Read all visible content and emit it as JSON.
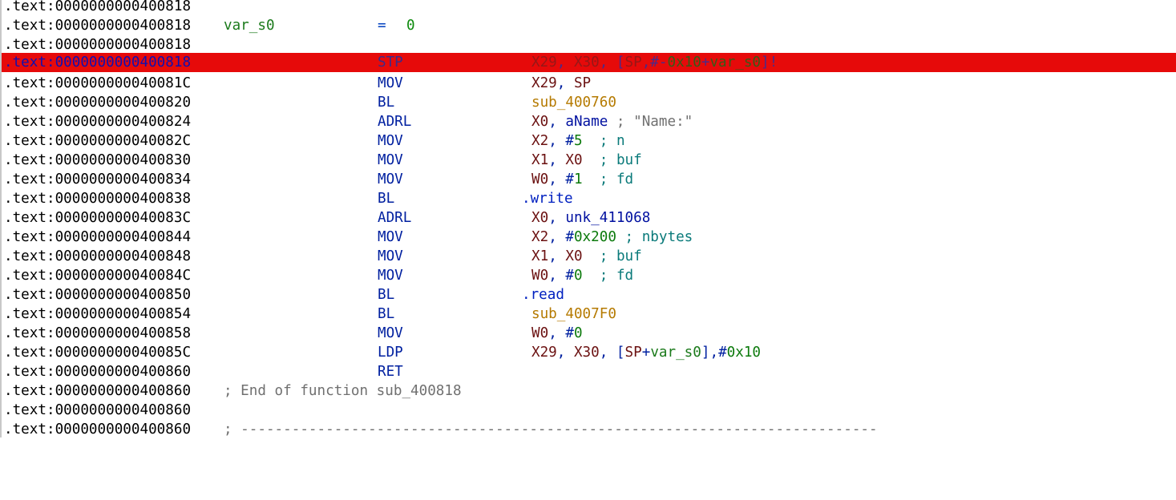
{
  "address_prefix": ".text:",
  "lines": [
    {
      "addr": "0000000000400818"
    },
    {
      "addr": "0000000000400818",
      "label": "var_s0",
      "eq": "=",
      "eqval": "0"
    },
    {
      "addr": "0000000000400818"
    },
    {
      "addr": "0000000000400818",
      "mnem": "STP",
      "highlight": true
    },
    {
      "addr": "000000000040081C",
      "mnem": "MOV"
    },
    {
      "addr": "0000000000400820",
      "mnem": "BL"
    },
    {
      "addr": "0000000000400824",
      "mnem": "ADRL"
    },
    {
      "addr": "000000000040082C",
      "mnem": "MOV"
    },
    {
      "addr": "0000000000400830",
      "mnem": "MOV"
    },
    {
      "addr": "0000000000400834",
      "mnem": "MOV"
    },
    {
      "addr": "0000000000400838",
      "mnem": "BL"
    },
    {
      "addr": "000000000040083C",
      "mnem": "ADRL"
    },
    {
      "addr": "0000000000400844",
      "mnem": "MOV"
    },
    {
      "addr": "0000000000400848",
      "mnem": "MOV"
    },
    {
      "addr": "000000000040084C",
      "mnem": "MOV"
    },
    {
      "addr": "0000000000400850",
      "mnem": "BL"
    },
    {
      "addr": "0000000000400854",
      "mnem": "BL"
    },
    {
      "addr": "0000000000400858",
      "mnem": "MOV"
    },
    {
      "addr": "000000000040085C",
      "mnem": "LDP"
    },
    {
      "addr": "0000000000400860",
      "mnem": "RET"
    },
    {
      "addr": "0000000000400860",
      "comment": "; End of function sub_400818"
    },
    {
      "addr": "0000000000400860"
    },
    {
      "addr": "0000000000400860",
      "comment": "; ---------------------------------------------------------------------------"
    }
  ],
  "operands": {
    "l3": {
      "r1": "X29",
      "c1": ", ",
      "r2": "X30",
      "c2": ", [",
      "r3": "SP",
      "c3": ",#-",
      "imm": "0x10",
      "plus": "+",
      "sym": "var_s0",
      "end": "]!"
    },
    "l4": {
      "r1": "X29",
      "c1": ", ",
      "r2": "SP"
    },
    "l5": {
      "sub": "sub_400760"
    },
    "l6": {
      "r1": "X0",
      "c1": ", ",
      "name": "aName",
      "cmt": " ; \"Name:\""
    },
    "l7": {
      "r1": "X2",
      "c1": ", ",
      "hash": "#",
      "imm": "5",
      "cmt": "  ; ",
      "arg": "n"
    },
    "l8": {
      "r1": "X1",
      "c1": ", ",
      "r2": "X0",
      "cmt": "  ; ",
      "arg": "buf"
    },
    "l9": {
      "r1": "W0",
      "c1": ", ",
      "hash": "#",
      "imm": "1",
      "cmt": "  ; ",
      "arg": "fd"
    },
    "l10": {
      "func": ".write"
    },
    "l11": {
      "r1": "X0",
      "c1": ", ",
      "name": "unk_411068"
    },
    "l12": {
      "r1": "X2",
      "c1": ", ",
      "hash": "#",
      "imm": "0x200",
      "cmt": " ; ",
      "arg": "nbytes"
    },
    "l13": {
      "r1": "X1",
      "c1": ", ",
      "r2": "X0",
      "cmt": "  ; ",
      "arg": "buf"
    },
    "l14": {
      "r1": "W0",
      "c1": ", ",
      "hash": "#",
      "imm": "0",
      "cmt": "  ; ",
      "arg": "fd"
    },
    "l15": {
      "func": ".read"
    },
    "l16": {
      "sub": "sub_4007F0"
    },
    "l17": {
      "r1": "W0",
      "c1": ", ",
      "hash": "#",
      "imm": "0"
    },
    "l18": {
      "r1": "X29",
      "c1": ", ",
      "r2": "X30",
      "c2": ", [",
      "r3": "SP",
      "plus": "+",
      "sym": "var_s0",
      "c3": "],",
      "hash": "#",
      "imm": "0x10"
    }
  }
}
